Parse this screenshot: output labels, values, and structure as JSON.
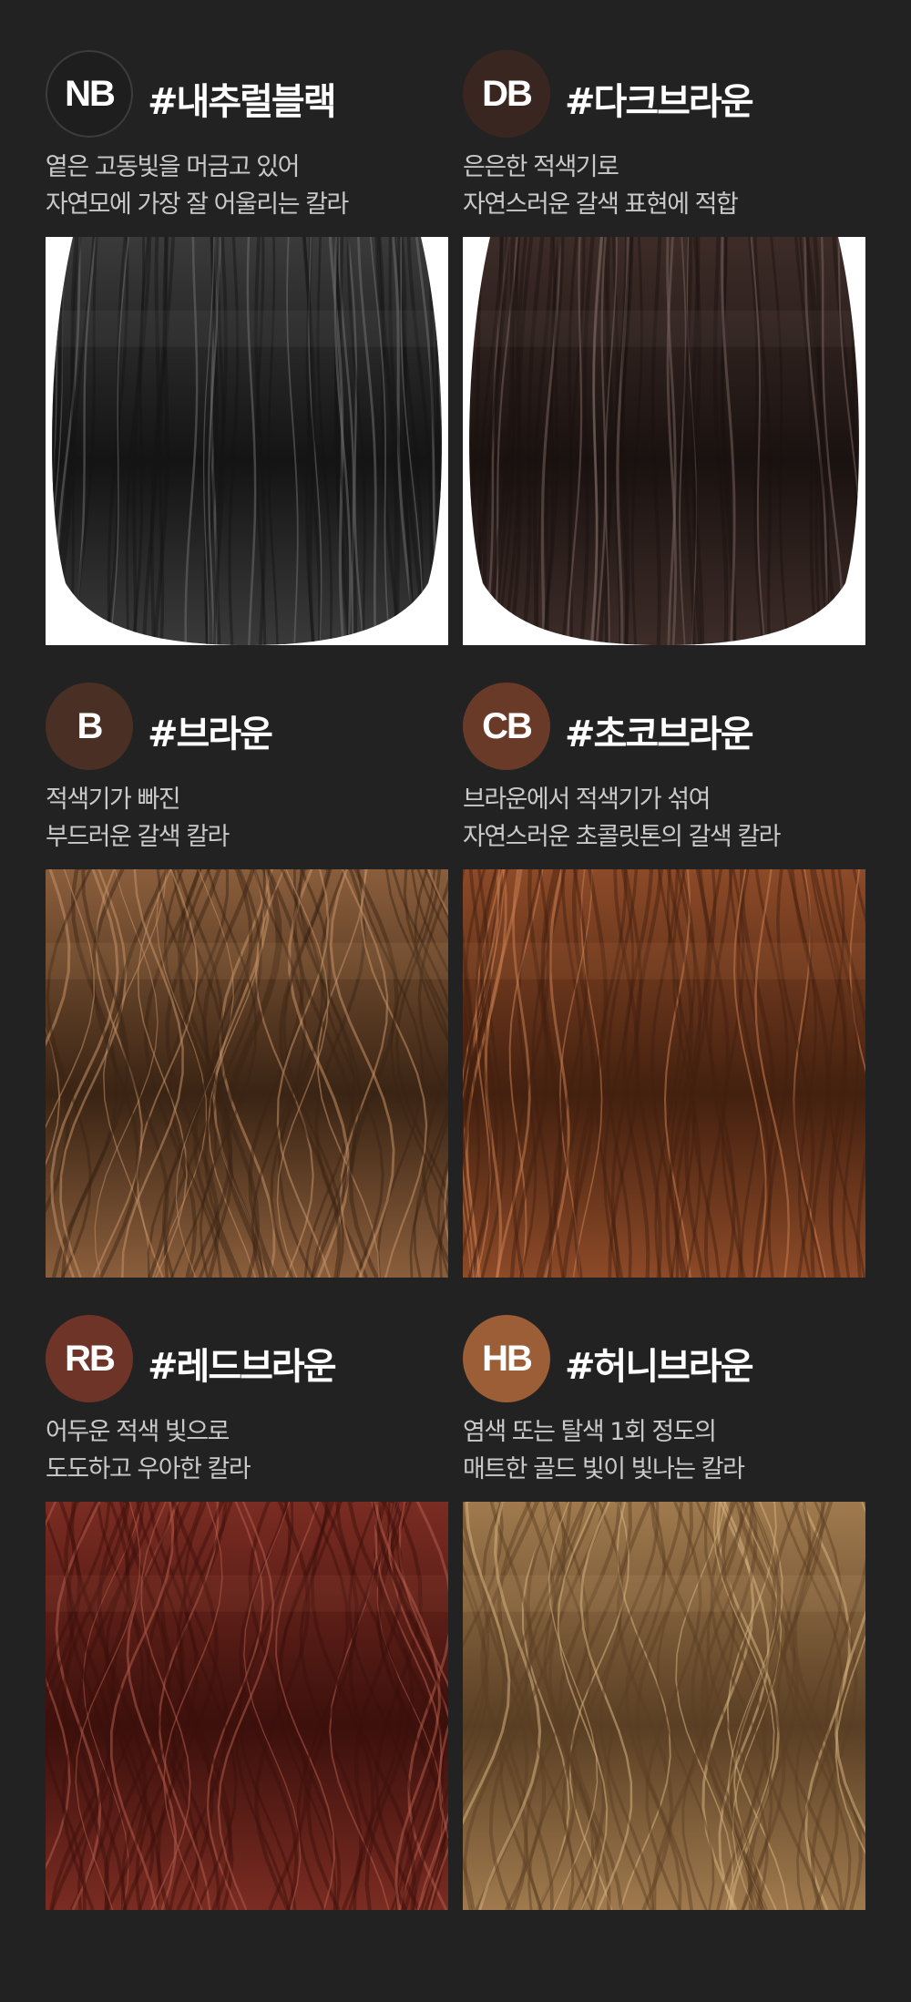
{
  "products": [
    {
      "code": "NB",
      "name": "#내추럴블랙",
      "desc": [
        "옅은 고동빛을 머금고 있어",
        "자연모에 가장 잘 어울리는 칼라"
      ],
      "badge_color": "#1e1e1e",
      "hair_light": "#3a3a3a",
      "hair_dark": "#141414",
      "hair_highlight": "#6e6e6e",
      "style": "straight"
    },
    {
      "code": "DB",
      "name": "#다크브라운",
      "desc": [
        "은은한 적색기로",
        "자연스러운 갈색 표현에 적합"
      ],
      "badge_color": "#3a2620",
      "hair_light": "#3d2c28",
      "hair_dark": "#1a1210",
      "hair_highlight": "#74615b",
      "style": "straight"
    },
    {
      "code": "B",
      "name": "#브라운",
      "desc": [
        "적색기가 빠진",
        "부드러운 갈색 칼라"
      ],
      "badge_color": "#4a2f24",
      "hair_light": "#8a5e3c",
      "hair_dark": "#3a2414",
      "hair_highlight": "#c39066",
      "style": "wavy"
    },
    {
      "code": "CB",
      "name": "#초코브라운",
      "desc": [
        "브라운에서 적색기가 섞여",
        "자연스러운 초콜릿톤의 갈색 칼라"
      ],
      "badge_color": "#6a3a28",
      "hair_light": "#8c4a28",
      "hair_dark": "#43200f",
      "hair_highlight": "#c67c4e",
      "style": "straight-loose"
    },
    {
      "code": "RB",
      "name": "#레드브라운",
      "desc": [
        "어두운 적색 빛으로",
        "도도하고 우아한 칼라"
      ],
      "badge_color": "#6e3428",
      "hair_light": "#7a2c22",
      "hair_dark": "#3c100c",
      "hair_highlight": "#b05a48",
      "style": "wavy"
    },
    {
      "code": "HB",
      "name": "#허니브라운",
      "desc": [
        "염색 또는 탈색 1회 정도의",
        "매트한 골드 빛이 빛나는 칼라"
      ],
      "badge_color": "#9b5e36",
      "hair_light": "#a07a4e",
      "hair_dark": "#5a3f24",
      "hair_highlight": "#d4b07e",
      "style": "wavy-light"
    }
  ]
}
